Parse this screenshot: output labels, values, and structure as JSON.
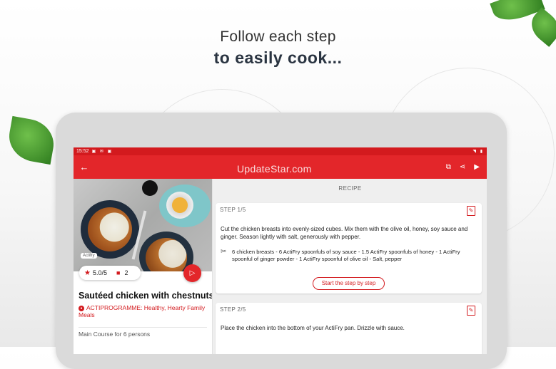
{
  "headline": {
    "line1": "Follow each step",
    "line2": "to easily cook..."
  },
  "statusbar": {
    "time": "15:52",
    "left_icons": "▣ ✉ ▣",
    "right_icons": "◥ ▮"
  },
  "appbar": {
    "back_icon": "arrow-back-icon",
    "watermark": "UpdateStar.com",
    "actions": [
      "cast-icon",
      "share-icon",
      "play-icon"
    ]
  },
  "recipe": {
    "tag": "Actifry",
    "rating": "5.0/5",
    "comments": "2",
    "title": "Sautéed chicken with chestnuts",
    "programme": "ACTIPROGRAMME: Healthy, Hearty Family Meals",
    "meta": "Main Course for 6 persons"
  },
  "steps_section": {
    "label": "RECIPE",
    "steps": [
      {
        "label": "STEP 1/5",
        "text": "Cut the chicken breasts into evenly-sized cubes. Mix them with the olive oil, honey, soy sauce and ginger. Season lightly with salt, generously with pepper.",
        "ingredients": "6 chicken breasts - 6 ActiFry spoonfuls of soy sauce - 1.5 ActiFry spoonfuls of honey - 1 ActiFry spoonful of ginger powder - 1 ActiFry spoonful of olive oil - Salt, pepper",
        "button": "Start the step by step"
      },
      {
        "label": "STEP 2/5",
        "text": "Place the chicken into the bottom of your ActiFry pan. Drizzle with sauce."
      }
    ]
  },
  "colors": {
    "brand_red": "#e3262a",
    "status_red": "#d31a1e"
  }
}
